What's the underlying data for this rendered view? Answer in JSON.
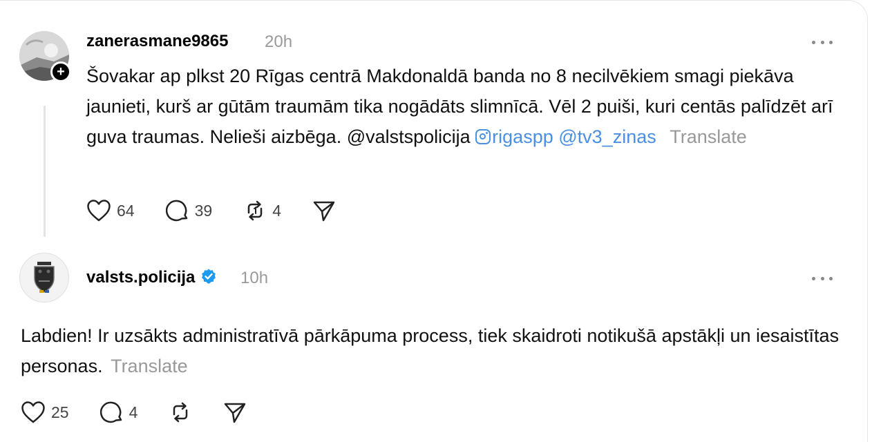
{
  "post1": {
    "username": "zanerasmane9865",
    "time": "20h",
    "text_main": "Šovakar ap plkst 20 Rīgas centrā Makdonaldā banda no 8 necilvēkiem smagi piekāva jaunieti, kurš ar gūtām traumām tika nogādāts slimnīcā. Vēl 2 puiši, kuri centās palīdzēt arī guva traumas. Nelieši aizbēga. @valstspolicija ",
    "ig_mention": "rigaspp",
    "mention2": "@tv3_zinas",
    "translate": "Translate",
    "likes": "64",
    "comments": "39",
    "reposts": "4",
    "follow_icon": "plus-icon"
  },
  "post2": {
    "username": "valsts.policija",
    "verified_icon": "verified-badge-icon",
    "time": "10h",
    "text_main": "Labdien! Ir uzsākts administratīvā pārkāpuma process, tiek skaidroti notikušā apstākļi un iesaistītas personas. ",
    "translate": "Translate",
    "likes": "25",
    "comments": "4"
  },
  "colors": {
    "link": "#4a90e2",
    "muted": "#999999",
    "verified": "#1d9bf0"
  }
}
